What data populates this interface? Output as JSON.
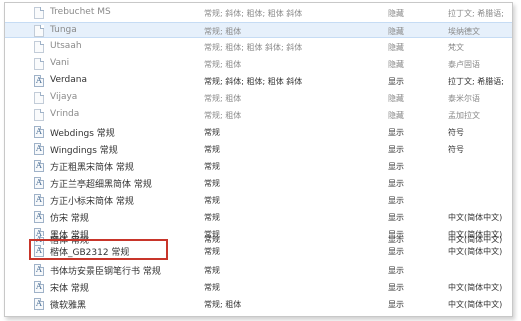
{
  "font_list": {
    "rows": [
      {
        "name": "Trebuchet MS",
        "style": "常规; 斜体; 粗体; 粗体 斜体",
        "show": "隐藏",
        "category": "拉丁文; 希腊语;",
        "icon": "font-file-icon",
        "hidden": true
      },
      {
        "name": "Tunga",
        "style": "常规; 粗体",
        "show": "隐藏",
        "category": "埃纳德文",
        "icon": "font-file-icon",
        "hidden": true,
        "selected": true
      },
      {
        "name": "Utsaah",
        "style": "常规; 粗体; 粗体 斜体; 斜体",
        "show": "隐藏",
        "category": "梵文",
        "icon": "font-file-icon",
        "hidden": true
      },
      {
        "name": "Vani",
        "style": "常规; 粗体",
        "show": "隐藏",
        "category": "泰卢固语",
        "icon": "font-file-icon",
        "hidden": true
      },
      {
        "name": "Verdana",
        "style": "常规; 斜体; 粗体; 粗体 斜体",
        "show": "显示",
        "category": "拉丁文; 希腊语;",
        "icon": "font-a-icon",
        "hidden": false
      },
      {
        "name": "Vijaya",
        "style": "常规; 粗体",
        "show": "隐藏",
        "category": "泰米尔语",
        "icon": "font-file-icon",
        "hidden": true
      },
      {
        "name": "Vrinda",
        "style": "常规; 粗体",
        "show": "隐藏",
        "category": "孟加拉文",
        "icon": "font-file-icon",
        "hidden": true
      },
      {
        "name": "Webdings 常规",
        "style": "常规",
        "show": "显示",
        "category": "符号",
        "icon": "font-a-icon",
        "hidden": false
      },
      {
        "name": "Wingdings 常规",
        "style": "常规",
        "show": "显示",
        "category": "符号",
        "icon": "font-a-icon",
        "hidden": false
      },
      {
        "name": "方正粗黑宋简体 常规",
        "style": "常规",
        "show": "显示",
        "category": "",
        "icon": "font-a-icon",
        "hidden": false
      },
      {
        "name": "方正兰亭超细黑简体 常规",
        "style": "常规",
        "show": "显示",
        "category": "",
        "icon": "font-a-icon",
        "hidden": false
      },
      {
        "name": "方正小标宋简体 常规",
        "style": "常规",
        "show": "显示",
        "category": "",
        "icon": "font-a-icon",
        "hidden": false
      },
      {
        "name": "仿宋 常规",
        "style": "常规",
        "show": "显示",
        "category": "中文(简体中文)",
        "icon": "font-a-icon",
        "hidden": false
      },
      {
        "name": "黑体 常规",
        "style": "常规",
        "show": "显示",
        "category": "中文(简体中文)",
        "icon": "font-a-icon",
        "hidden": false
      },
      {
        "name": "楷体 常规",
        "style": "常规",
        "show": "显示",
        "category": "中文(简体中文)",
        "icon": "font-a-icon",
        "hidden": false
      },
      {
        "name": "楷体_GB2312 常规",
        "style": "常规",
        "show": "显示",
        "category": "中文(简体中文)",
        "icon": "font-a-icon",
        "hidden": false,
        "annotated": true
      },
      {
        "name": "书体坊安景臣钢笔行书 常规",
        "style": "常规",
        "show": "显示",
        "category": "",
        "icon": "font-a-icon",
        "hidden": false
      },
      {
        "name": "宋体 常规",
        "style": "常规",
        "show": "显示",
        "category": "中文(简体中文)",
        "icon": "font-a-icon",
        "hidden": false
      },
      {
        "name": "微软雅黑",
        "style": "常规; 粗体",
        "show": "显示",
        "category": "中文(简体中文)",
        "icon": "font-a-icon",
        "hidden": false
      }
    ]
  },
  "colors": {
    "annotation_border": "#c8352a",
    "selection_background": "#e6f0fb"
  }
}
